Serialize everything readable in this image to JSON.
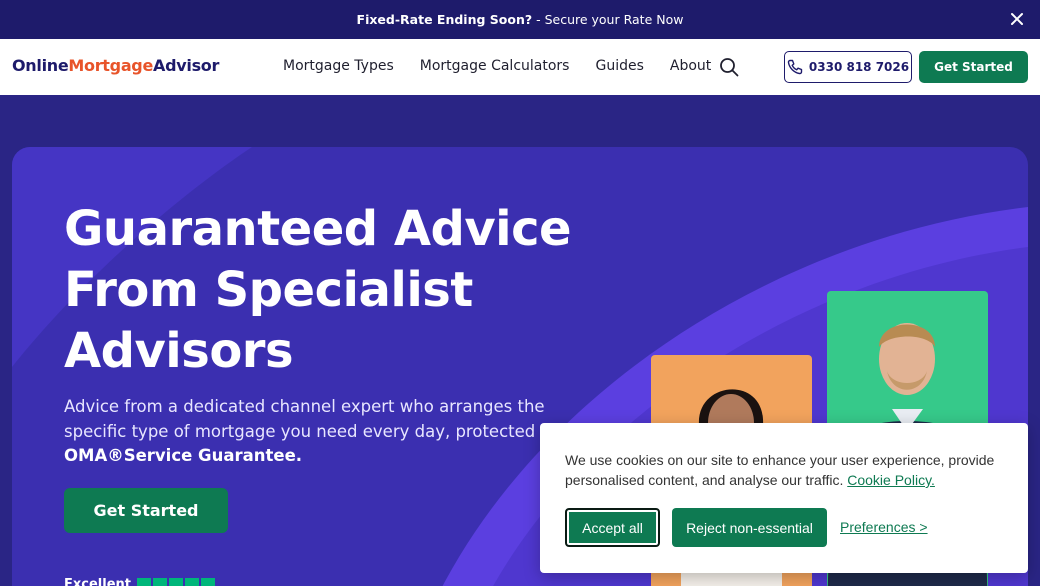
{
  "banner": {
    "bold": "Fixed-Rate Ending Soon?",
    "rest": " - Secure your Rate Now"
  },
  "logo": {
    "part1": "Online",
    "part2": "Mortgage",
    "part3": "Advisor"
  },
  "nav": {
    "items": [
      "Mortgage Types",
      "Mortgage Calculators",
      "Guides",
      "About"
    ]
  },
  "header": {
    "phone": "0330 818 7026",
    "cta": "Get Started"
  },
  "hero": {
    "title": "Guaranteed Advice From Specialist Advisors",
    "subtitle": "Advice from a dedicated channel expert who arranges the specific type of mortgage you need every day, protected by",
    "subtitle_bold": "OMA®Service Guarantee.",
    "cta": "Get Started",
    "rating_label": "Excellent"
  },
  "cookie": {
    "text": "We use cookies on our site to enhance your user experience, provide personalised content, and analyse our traffic.",
    "policy_link": "Cookie Policy.",
    "accept": "Accept all",
    "reject": "Reject non-essential",
    "preferences": "Preferences >"
  },
  "colors": {
    "navy": "#1e1b6b",
    "brand_orange": "#e8542a",
    "green": "#0e7a52",
    "hero_purple": "#3b2fb0"
  }
}
